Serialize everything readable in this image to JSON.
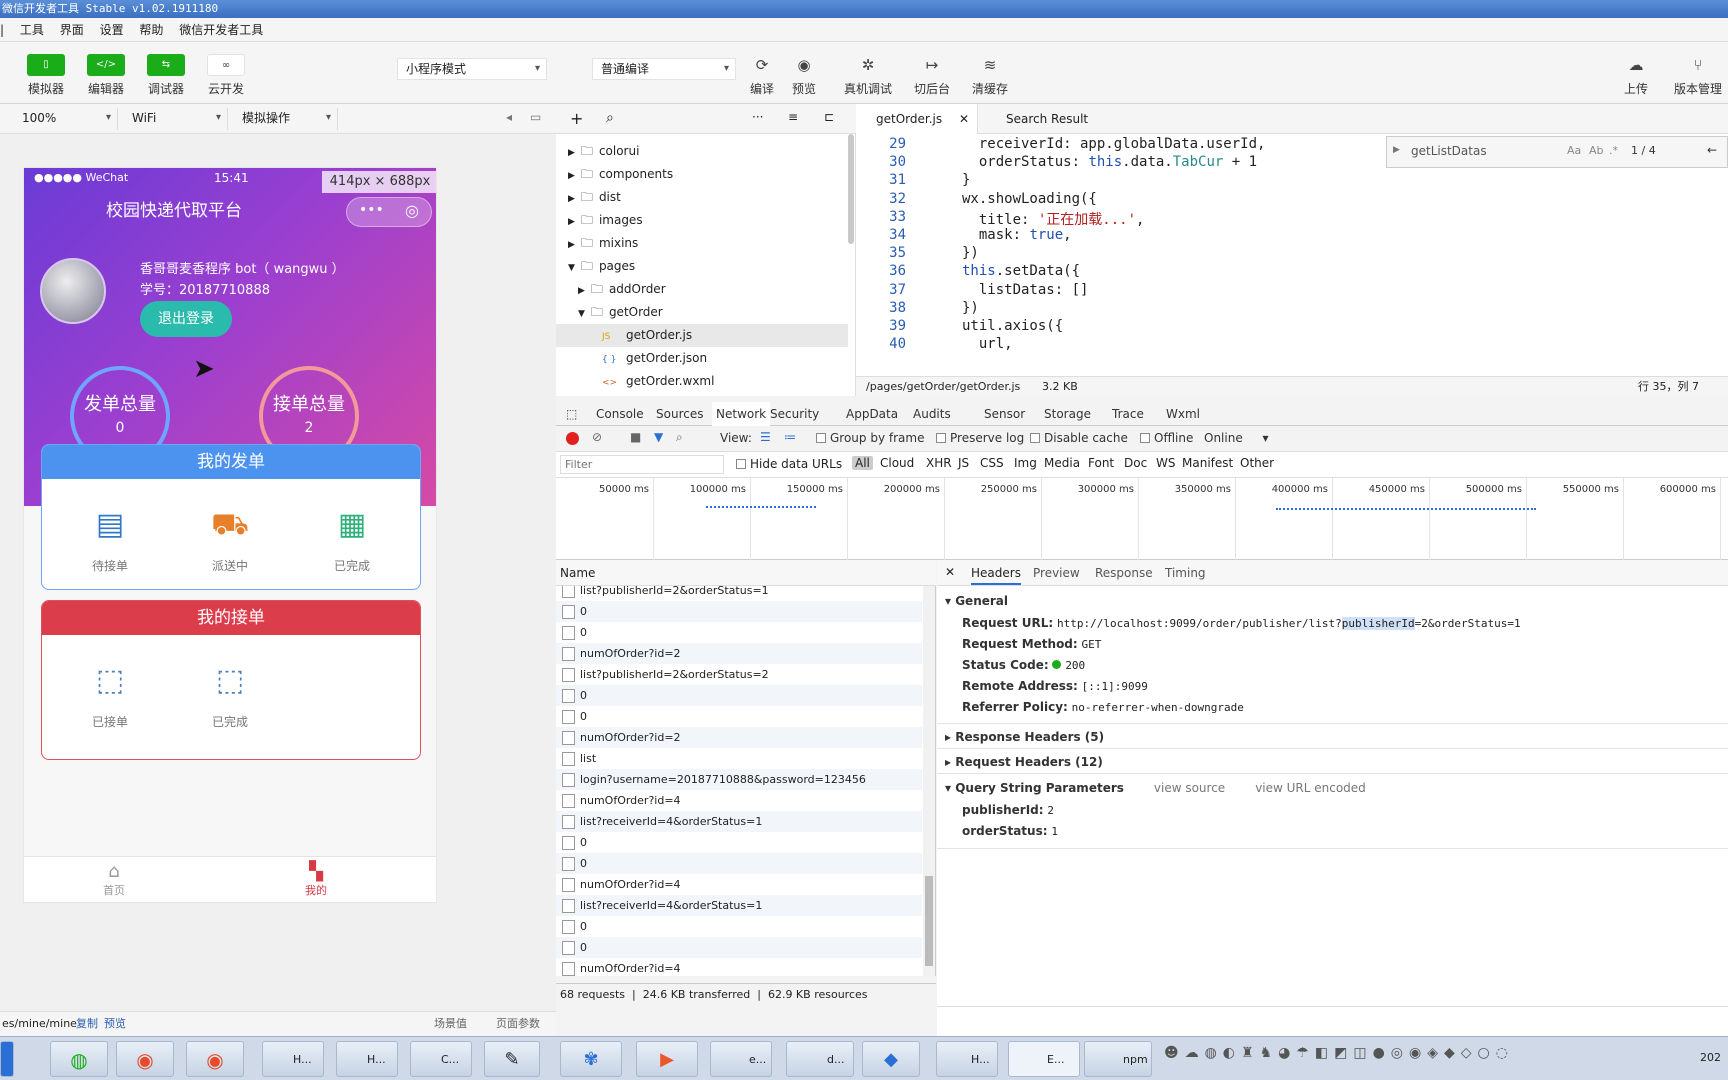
{
  "window": {
    "title": "微信开发者工具 Stable v1.02.1911180"
  },
  "menu": [
    "工具",
    "界面",
    "设置",
    "帮助",
    "微信开发者工具"
  ],
  "toolbar": {
    "simulator": "模拟器",
    "editor": "编辑器",
    "debugger": "调试器",
    "cloud": "云开发",
    "mode_select": "小程序模式",
    "compile_select": "普通编译",
    "compile": "编译",
    "preview": "预览",
    "real_debug": "真机调试",
    "backend": "切后台",
    "clear_cache": "清缓存",
    "upload": "上传",
    "version": "版本管理"
  },
  "sim_toolbar": {
    "zoom": "100%",
    "network": "WiFi",
    "ops": "模拟操作"
  },
  "phone": {
    "status_left": "●●●●● WeChat",
    "time": "15:41",
    "size": "414px × 688px",
    "nav_title": "校园快递代取平台",
    "user_name": "香哥哥麦香程序 bot（ wangwu ）",
    "student_id": "学号：20187710888",
    "logout": "退出登录",
    "stat1_label": "发单总量",
    "stat1_value": "0",
    "stat2_label": "接单总量",
    "stat2_value": "2",
    "card1": {
      "title": "我的发单",
      "items": [
        "待接单",
        "派送中",
        "已完成"
      ]
    },
    "card2": {
      "title": "我的接单",
      "items": [
        "已接单",
        "已完成"
      ]
    },
    "tab_home": "首页",
    "tab_mine": "我的"
  },
  "sim_status": {
    "path": "es/mine/mine",
    "copy": "复制",
    "preview": "预览",
    "scene": "场景值",
    "params": "页面参数"
  },
  "file_tree": [
    {
      "name": "colorui",
      "type": "folder",
      "level": 0,
      "open": false
    },
    {
      "name": "components",
      "type": "folder",
      "level": 0,
      "open": false
    },
    {
      "name": "dist",
      "type": "folder",
      "level": 0,
      "open": false
    },
    {
      "name": "images",
      "type": "folder",
      "level": 0,
      "open": false
    },
    {
      "name": "mixins",
      "type": "folder",
      "level": 0,
      "open": false
    },
    {
      "name": "pages",
      "type": "folder",
      "level": 0,
      "open": true
    },
    {
      "name": "addOrder",
      "type": "folder",
      "level": 1,
      "open": false
    },
    {
      "name": "getOrder",
      "type": "folder",
      "level": 1,
      "open": true
    },
    {
      "name": "getOrder.js",
      "type": "js",
      "level": 2,
      "selected": true
    },
    {
      "name": "getOrder.json",
      "type": "json",
      "level": 2
    },
    {
      "name": "getOrder.wxml",
      "type": "wxml",
      "level": 2
    }
  ],
  "editor": {
    "tab1": "getOrder.js",
    "tab2": "Search Result",
    "search_text": "getListDatas",
    "search_count": "1 / 4",
    "status_path": "/pages/getOrder/getOrder.js",
    "status_size": "3.2 KB",
    "cursor": "行 35，列 7",
    "lines": [
      {
        "n": "29",
        "t": "  receiverId: app.globalData.userId,"
      },
      {
        "n": "30",
        "t": "  orderStatus: this.data.TabCur + 1"
      },
      {
        "n": "31",
        "t": "}"
      },
      {
        "n": "32",
        "t": "wx.showLoading({"
      },
      {
        "n": "33",
        "t": "  title: '正在加载...',"
      },
      {
        "n": "34",
        "t": "  mask: true,"
      },
      {
        "n": "35",
        "t": "})"
      },
      {
        "n": "36",
        "t": "this.setData({"
      },
      {
        "n": "37",
        "t": "  listDatas: []"
      },
      {
        "n": "38",
        "t": "})"
      },
      {
        "n": "39",
        "t": "util.axios({"
      },
      {
        "n": "40",
        "t": "  url,"
      }
    ]
  },
  "devtools": {
    "tabs": [
      "Console",
      "Sources",
      "Network",
      "Security",
      "AppData",
      "Audits",
      "Sensor",
      "Storage",
      "Trace",
      "Wxml"
    ],
    "active_tab": "Network",
    "view_label": "View:",
    "group_by_frame": "Group by frame",
    "preserve_log": "Preserve log",
    "disable_cache": "Disable cache",
    "offline": "Offline",
    "online": "Online",
    "filter_placeholder": "Filter",
    "hide_data_urls": "Hide data URLs",
    "types": [
      "All",
      "Cloud",
      "XHR",
      "JS",
      "CSS",
      "Img",
      "Media",
      "Font",
      "Doc",
      "WS",
      "Manifest",
      "Other"
    ],
    "timeline_ticks": [
      "50000 ms",
      "100000 ms",
      "150000 ms",
      "200000 ms",
      "250000 ms",
      "300000 ms",
      "350000 ms",
      "400000 ms",
      "450000 ms",
      "500000 ms",
      "550000 ms",
      "600000 ms"
    ],
    "name_header": "Name",
    "requests": [
      "list?publisherId=2&orderStatus=1",
      "0",
      "0",
      "numOfOrder?id=2",
      "list?publisherId=2&orderStatus=2",
      "0",
      "0",
      "numOfOrder?id=2",
      "list",
      "login?username=20187710888&password=123456",
      "numOfOrder?id=4",
      "list?receiverId=4&orderStatus=1",
      "0",
      "0",
      "numOfOrder?id=4",
      "list?receiverId=4&orderStatus=1",
      "0",
      "0",
      "numOfOrder?id=4"
    ],
    "summary": "68 requests  |  24.6 KB transferred  |  62.9 KB resources",
    "detail_tabs": [
      "Headers",
      "Preview",
      "Response",
      "Timing"
    ],
    "general": "General",
    "request_url_label": "Request URL:",
    "request_url_pre": "http://localhost:9099/order/publisher/list?",
    "request_url_hl": "publisherId",
    "request_url_post": "=2&orderStatus=1",
    "method_label": "Request Method:",
    "method": "GET",
    "status_label": "Status Code:",
    "status": "200",
    "remote_label": "Remote Address:",
    "remote": "[::1]:9099",
    "referrer_label": "Referrer Policy:",
    "referrer": "no-referrer-when-downgrade",
    "response_headers": "Response Headers (5)",
    "request_headers": "Request Headers (12)",
    "qsp": "Query String Parameters",
    "view_source": "view source",
    "view_url_encoded": "view URL encoded",
    "param1_k": "publisherId:",
    "param1_v": "2",
    "param2_k": "orderStatus:",
    "param2_v": "1"
  },
  "taskbar": {
    "items": [
      "H...",
      "H...",
      "C...",
      "e...",
      "d...",
      "H...",
      "E...",
      "npm"
    ],
    "clock": "202"
  }
}
